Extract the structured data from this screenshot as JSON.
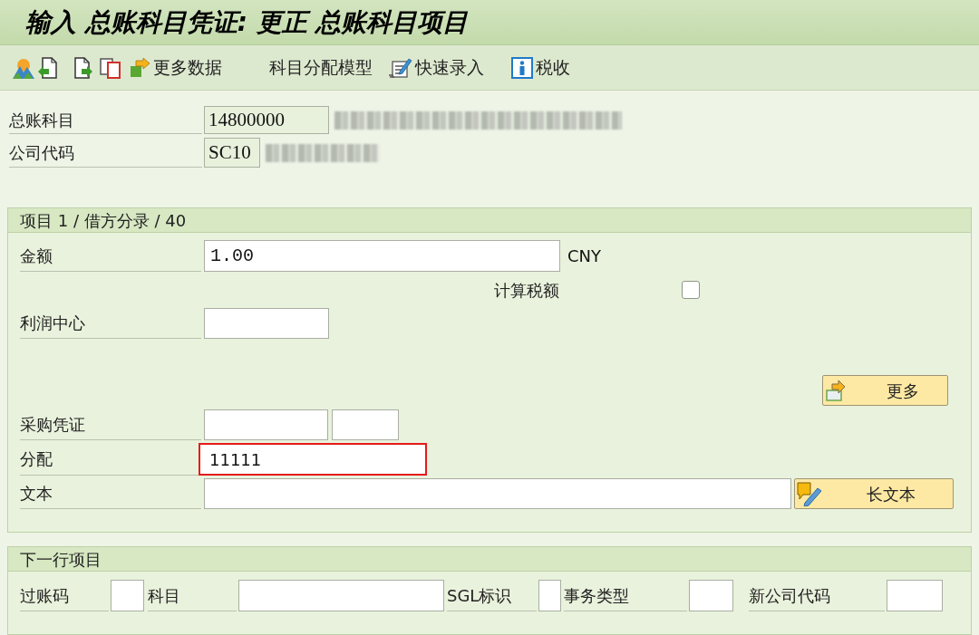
{
  "window": {
    "title": "输入 总账科目凭证: 更正 总账科目项目"
  },
  "toolbar": [
    {
      "label": "更多数据"
    },
    {
      "label": "科目分配模型"
    },
    {
      "label": "快速录入"
    },
    {
      "label": "税收"
    }
  ],
  "header_fields": [
    {
      "label": "总账科目",
      "value": "14800000"
    },
    {
      "label": "公司代码",
      "value": "SC10"
    }
  ],
  "line_item": {
    "title": "项目 1 / 借方分录 / 40",
    "amount": {
      "label": "金额",
      "value": "1.00",
      "currency": "CNY"
    },
    "calculate_tax": {
      "label": "计算税额",
      "checked": false
    },
    "profit_center": {
      "label": "利润中心"
    },
    "more_button": {
      "label": "更多"
    },
    "purchasing_document": {
      "label": "采购凭证"
    },
    "assignment": {
      "label": "分配",
      "value": "11111",
      "highlighted": true
    },
    "text": {
      "label": "文本"
    },
    "long_text_button": {
      "label": "长文本"
    }
  },
  "next_line_item": {
    "title": "下一行项目",
    "fields": [
      {
        "label": "过账码"
      },
      {
        "label": "科目"
      },
      {
        "label": "SGL标识"
      },
      {
        "label": "事务类型"
      },
      {
        "label": "新公司代码"
      }
    ]
  }
}
